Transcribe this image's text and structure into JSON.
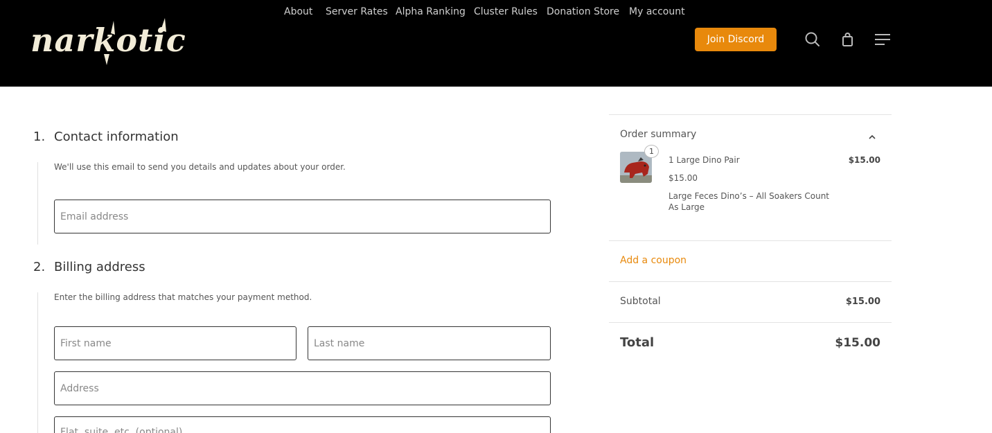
{
  "header": {
    "logo_text": "narkotics",
    "nav": [
      {
        "label": "About"
      },
      {
        "label": "Server Rates"
      },
      {
        "label": "Alpha Ranking"
      },
      {
        "label": "Cluster Rules"
      },
      {
        "label": "Donation Store"
      },
      {
        "label": "My account"
      }
    ],
    "cta_label": "Join Discord",
    "icons": [
      "search-icon",
      "shopping-bag-icon",
      "menu-icon"
    ],
    "accent_color": "#e8890c"
  },
  "contact": {
    "number": "1.",
    "title": "Contact information",
    "description": "We'll use this email to send you details and updates about your order.",
    "email_placeholder": "Email address"
  },
  "billing": {
    "number": "2.",
    "title": "Billing address",
    "description": "Enter the billing address that matches your payment method.",
    "first_name_placeholder": "First name",
    "last_name_placeholder": "Last name",
    "address_placeholder": "Address",
    "address2_placeholder": "Flat, suite, etc. (optional)"
  },
  "summary": {
    "title": "Order summary",
    "item": {
      "quantity": "1",
      "name": "1 Large Dino Pair",
      "unit_price": "$15.00",
      "description": "Large Feces Dino’s – All Soakers Count As Large",
      "line_total": "$15.00"
    },
    "coupon_label": "Add a coupon",
    "subtotal_label": "Subtotal",
    "subtotal_value": "$15.00",
    "total_label": "Total",
    "total_value": "$15.00"
  }
}
